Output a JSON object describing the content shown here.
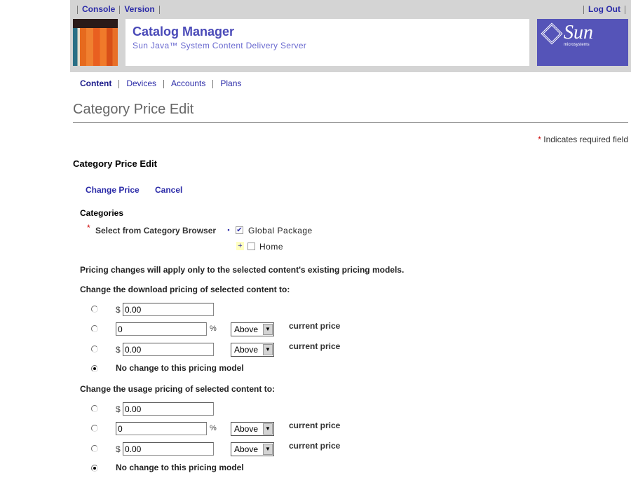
{
  "masthead": {
    "console": "Console",
    "version": "Version",
    "logout": "Log Out",
    "app_title": "Catalog Manager",
    "app_subtitle": "Sun Java™ System Content Delivery Server",
    "logo": "Sun microsystems",
    "logo_small": "microsystems"
  },
  "nav": {
    "items": [
      "Content",
      "Devices",
      "Accounts",
      "Plans"
    ],
    "active": "Content"
  },
  "page_title": "Category Price Edit",
  "required_note": "Indicates required field",
  "section_title": "Category Price Edit",
  "actions": {
    "change_price": "Change Price",
    "cancel": "Cancel"
  },
  "categories": {
    "label": "Categories",
    "select_label": "Select from Category Browser",
    "tree": [
      {
        "label": "Global Package",
        "checked": true,
        "expanded": true
      },
      {
        "label": "Home",
        "checked": false,
        "expanded": false
      }
    ]
  },
  "notice": "Pricing changes will apply only to the selected content's existing pricing models.",
  "download": {
    "heading": "Change the download pricing of selected content to:",
    "fixed": "0.00",
    "percent": "0",
    "amount": "0.00",
    "direction1": "Above",
    "direction2": "Above",
    "current": "current price",
    "nochange": "No change to this pricing model",
    "selected": "nochange"
  },
  "usage": {
    "heading": "Change the usage pricing of selected content to:",
    "fixed": "0.00",
    "percent": "0",
    "amount": "0.00",
    "direction1": "Above",
    "direction2": "Above",
    "current": "current price",
    "nochange": "No change to this pricing model",
    "selected": "nochange"
  },
  "symbols": {
    "dollar": "$",
    "percent": "%",
    "asterisk": "*"
  },
  "colors": {
    "link": "#2b2ba8",
    "header_bg": "#d4d4d4",
    "sun_bg": "#5554b8",
    "required": "#cc0000"
  }
}
